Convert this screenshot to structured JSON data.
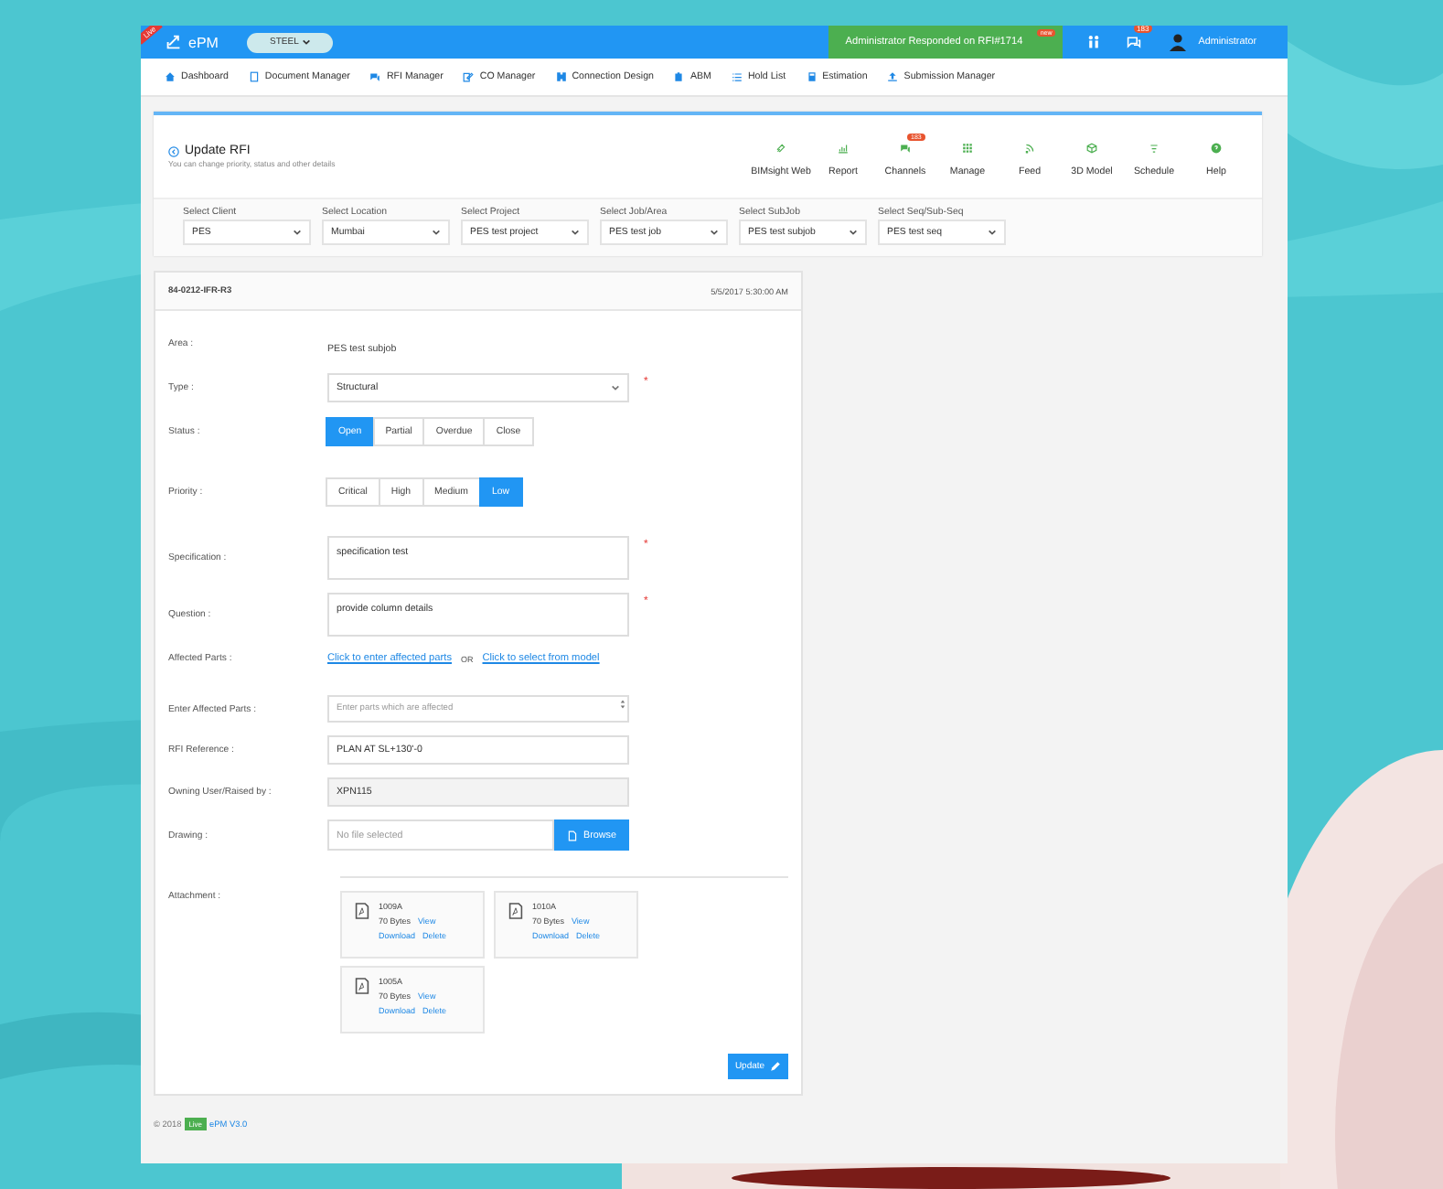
{
  "header": {
    "ribbon": "Live",
    "logo": "ePM",
    "module": "STEEL",
    "notification": "Administrator Responded on RFI#1714",
    "notification_badge": "new",
    "chat_badge": "183",
    "user": "Administrator"
  },
  "nav": [
    {
      "label": "Dashboard"
    },
    {
      "label": "Document Manager"
    },
    {
      "label": "RFI Manager"
    },
    {
      "label": "CO Manager"
    },
    {
      "label": "Connection Design"
    },
    {
      "label": "ABM"
    },
    {
      "label": "Hold List"
    },
    {
      "label": "Estimation"
    },
    {
      "label": "Submission Manager"
    }
  ],
  "page": {
    "title": "Update RFI",
    "subtitle": "You can change priority, status and other details",
    "tools": [
      {
        "label": "BIMsight Web"
      },
      {
        "label": "Report"
      },
      {
        "label": "Channels",
        "badge": "183"
      },
      {
        "label": "Manage"
      },
      {
        "label": "Feed"
      },
      {
        "label": "3D Model"
      },
      {
        "label": "Schedule"
      },
      {
        "label": "Help"
      }
    ],
    "filters": [
      {
        "label": "Select Client",
        "value": "PES"
      },
      {
        "label": "Select Location",
        "value": "Mumbai"
      },
      {
        "label": "Select Project",
        "value": "PES test project"
      },
      {
        "label": "Select Job/Area",
        "value": "PES test job"
      },
      {
        "label": "Select SubJob",
        "value": "PES test subjob"
      },
      {
        "label": "Select Seq/Sub-Seq",
        "value": "PES test seq"
      }
    ]
  },
  "form": {
    "id": "84-0212-IFR-R3",
    "date": "5/5/2017 5:30:00 AM",
    "fields": [
      {
        "kind": "text",
        "label": "Area :",
        "value": "PES test subjob"
      },
      {
        "kind": "select",
        "label": "Type :",
        "value": "Structural",
        "required_mark": "*"
      },
      {
        "kind": "segmented",
        "label": "Status :",
        "options": [
          {
            "label": "Open",
            "selected": true
          },
          {
            "label": "Partial",
            "selected": false
          },
          {
            "label": "Overdue",
            "selected": false
          },
          {
            "label": "Close",
            "selected": false
          }
        ]
      },
      {
        "kind": "segmented",
        "label": "Priority :",
        "options": [
          {
            "label": "Critical",
            "selected": false
          },
          {
            "label": "High",
            "selected": false
          },
          {
            "label": "Medium",
            "selected": false
          },
          {
            "label": "Low",
            "selected": true
          }
        ]
      },
      {
        "kind": "textarea",
        "label": "Specification :",
        "value": "specification test",
        "required_mark": "*"
      },
      {
        "kind": "textarea",
        "label": "Question :",
        "value": "provide column details",
        "required_mark": "*"
      },
      {
        "kind": "links",
        "label": "Affected Parts :",
        "links": [
          "Click to enter affected parts",
          "Click to select from model"
        ],
        "separator": "OR"
      },
      {
        "kind": "spin",
        "label": "Enter Affected Parts :",
        "placeholder": "Enter parts which are affected"
      },
      {
        "kind": "input",
        "label": "RFI Reference :",
        "value": "PLAN AT SL+130'-0",
        "disabled": false
      },
      {
        "kind": "input",
        "label": "Owning User/Raised by :",
        "value": "XPN115",
        "disabled": true
      },
      {
        "kind": "file",
        "label": "Drawing :",
        "placeholder": "No file selected",
        "button": "Browse"
      },
      {
        "kind": "attachments",
        "label": "Attachment :",
        "files": [
          {
            "name": "1009A",
            "size": "70 Bytes",
            "actions": [
              "View",
              "Download",
              "Delete"
            ]
          },
          {
            "name": "1010A",
            "size": "70 Bytes",
            "actions": [
              "View",
              "Download",
              "Delete"
            ]
          },
          {
            "name": "1005A",
            "size": "70 Bytes",
            "actions": [
              "View",
              "Download",
              "Delete"
            ]
          }
        ]
      }
    ],
    "submit": "Update"
  },
  "footer": {
    "copyright": "© 2018",
    "badge": "Live",
    "version": "ePM V3.0"
  }
}
